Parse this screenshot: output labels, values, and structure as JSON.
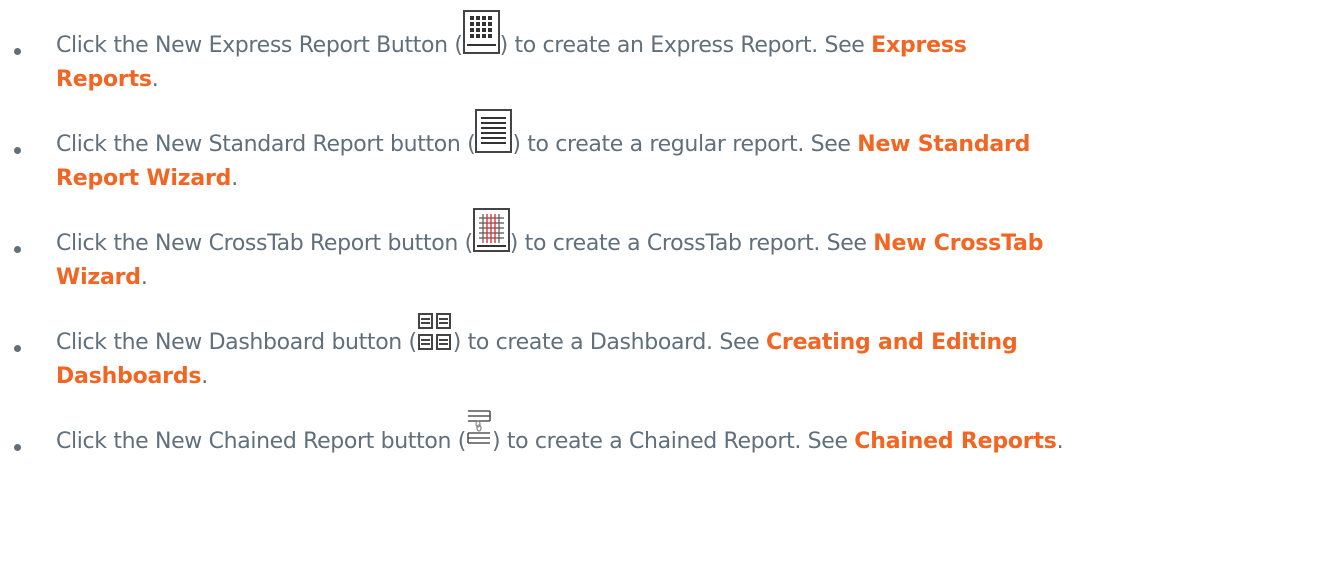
{
  "items": [
    {
      "before": "Click the New Express Report Button (",
      "icon": "express-report-icon",
      "after": ") to create an Express Report. See ",
      "link": "Express",
      "link_cont": "Reports",
      "end": "."
    },
    {
      "before": "Click the New Standard Report button (",
      "icon": "standard-report-icon",
      "after": ") to create a regular report. See ",
      "link": "New Standard",
      "link_cont": "Report Wizard",
      "end": "."
    },
    {
      "before": "Click the New CrossTab Report button (",
      "icon": "crosstab-report-icon",
      "after": ") to create a CrossTab report. See ",
      "link": "New CrossTab",
      "link_cont": "Wizard",
      "end": "."
    },
    {
      "before": "Click the New Dashboard button (",
      "icon": "dashboard-icon",
      "after": ") to create a Dashboard. See ",
      "link": "Creating and Editing",
      "link_cont": "Dashboards",
      "end": "."
    },
    {
      "before": "Click the New Chained Report button (",
      "icon": "chained-report-icon",
      "after": ") to create a Chained Report. See ",
      "link": "Chained Reports",
      "end": "."
    }
  ],
  "colors": {
    "text": "#5f6f7c",
    "link": "#f26522"
  }
}
